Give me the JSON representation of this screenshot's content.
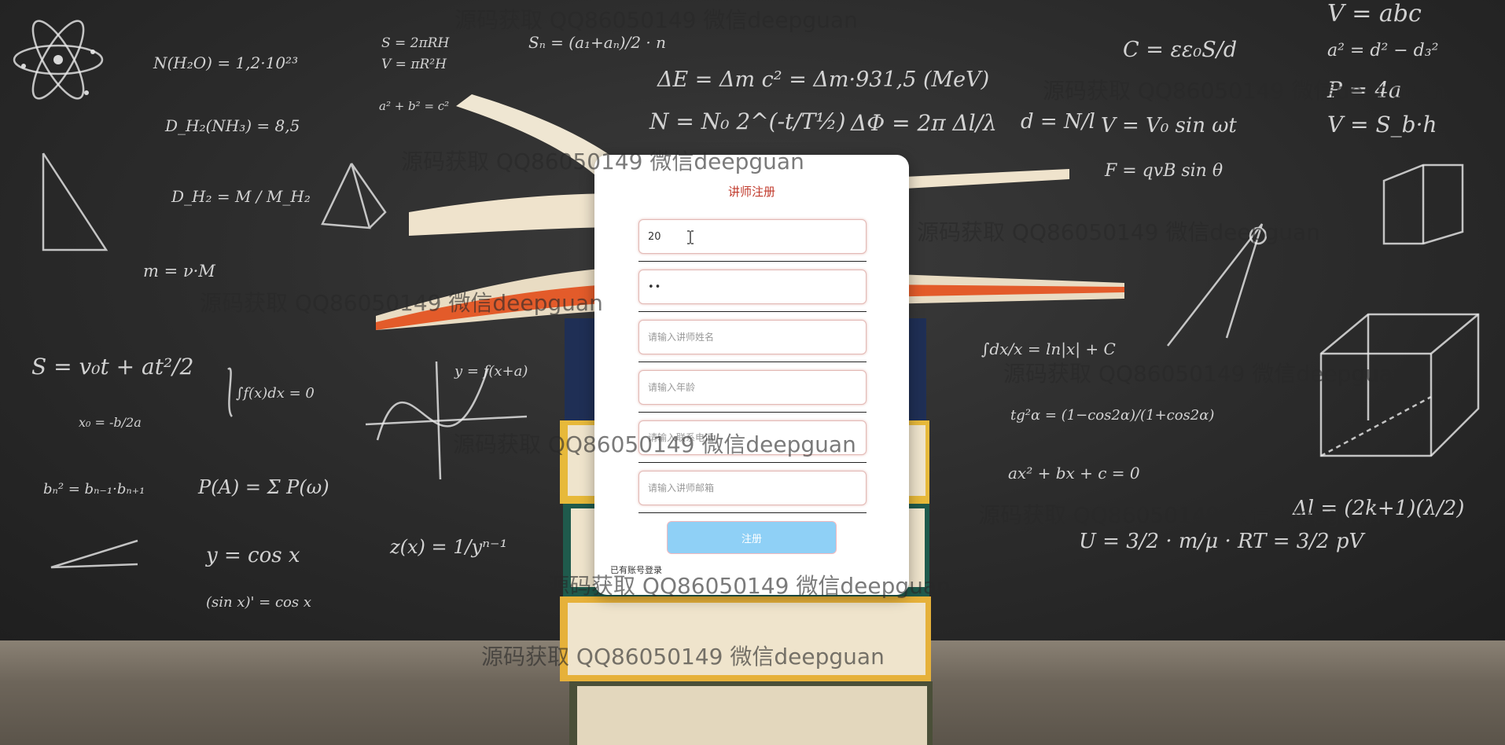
{
  "form": {
    "title": "讲师注册",
    "username_value": "20",
    "password_value": "••",
    "name_placeholder": "请输入讲师姓名",
    "age_placeholder": "请输入年龄",
    "phone_placeholder": "请输入联系电话",
    "email_placeholder": "请输入讲师邮箱",
    "register_label": "注册",
    "login_link": "已有账号登录"
  },
  "watermarks": [
    "源码获取 QQ86050149 微信deepguan",
    "源码获取 QQ86050149 微信deepguan",
    "源码获取 QQ86050149 微信deepguan",
    "源码获取 QQ86050149 微信deepguan",
    "源码获取 QQ86050149 微信deepguan",
    "源码获取 QQ86050149 微信deepguan",
    "源码获取 QQ86050149 微信deepguan",
    "源码获取 QQ86050149 微信deepguan",
    "源码获取 QQ86050149 微信deepguan",
    "源码获取 QQ86050149 微信deepguan"
  ],
  "formulas": [
    "N(H₂O) = 1,2·10²³",
    "D_H₂(NH₃) = 8,5",
    "D_H₂ = M / M_H₂",
    "m = ν·M",
    "S = v₀t + at²/2",
    "x₀ = -b/2a",
    "bₙ² = bₙ₋₁·bₙ₊₁",
    "P(A) = Σ P(ω)",
    "y = cos x",
    "(sin x)' = cos x",
    "z(x) = 1/yⁿ⁻¹",
    "∫f(x)dx = 0",
    "y = f(x+a)",
    "S = 2πRH",
    "V = πR²H",
    "a² + b² = c²",
    "Sₙ = (a₁+aₙ)/2 · n",
    "ΔE = Δm c² = Δm·931,5 (MeV)",
    "N = N₀ 2^(-t/T½)",
    "ΔΦ = 2π Δl/λ",
    "d = N/l",
    "V = V₀ sin ωt",
    "F = qvB sin θ",
    "C = εε₀S/d",
    "V = abc",
    "a² = d² − d₃²",
    "P = 4a",
    "V = S_b·h",
    "∫dx/x = ln|x| + C",
    "tg²α = (1−cos2α)/(1+cos2α)",
    "ax² + bx + c = 0",
    "Δl = (2k+1)(λ/2)",
    "U = 3/2 · m/μ · RT = 3/2 pV"
  ]
}
